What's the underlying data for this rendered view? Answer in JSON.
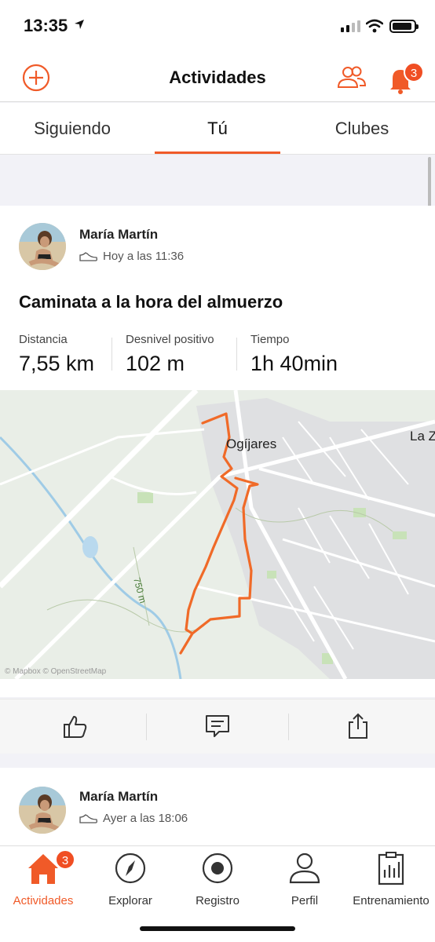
{
  "status_bar": {
    "time": "13:35"
  },
  "header": {
    "title": "Actividades",
    "notification_count": "3"
  },
  "tabs": [
    {
      "label": "Siguiendo",
      "active": false
    },
    {
      "label": "Tú",
      "active": true
    },
    {
      "label": "Clubes",
      "active": false
    }
  ],
  "feed": [
    {
      "athlete": "María Martín",
      "when": "Hoy a las 11:36",
      "title": "Caminata a la hora del almuerzo",
      "stats": [
        {
          "label": "Distancia",
          "value": "7,55 km"
        },
        {
          "label": "Desnivel positivo",
          "value": "102 m"
        },
        {
          "label": "Tiempo",
          "value": "1h 40min"
        }
      ],
      "map": {
        "town_label": "Ogíjares",
        "town_label_2": "La Z",
        "contour_label": "750 m",
        "attribution": "© Mapbox © OpenStreetMap"
      }
    },
    {
      "athlete": "María Martín",
      "when": "Ayer a las 18:06"
    }
  ],
  "tab_bar": [
    {
      "label": "Actividades",
      "icon": "home-icon",
      "active": true,
      "badge": "3"
    },
    {
      "label": "Explorar",
      "icon": "compass-icon",
      "active": false
    },
    {
      "label": "Registro",
      "icon": "record-icon",
      "active": false
    },
    {
      "label": "Perfil",
      "icon": "profile-icon",
      "active": false
    },
    {
      "label": "Entrenamiento",
      "icon": "training-icon",
      "active": false
    }
  ],
  "colors": {
    "accent": "#f05a28",
    "badge": "#f04e23",
    "route": "#f06a28"
  }
}
